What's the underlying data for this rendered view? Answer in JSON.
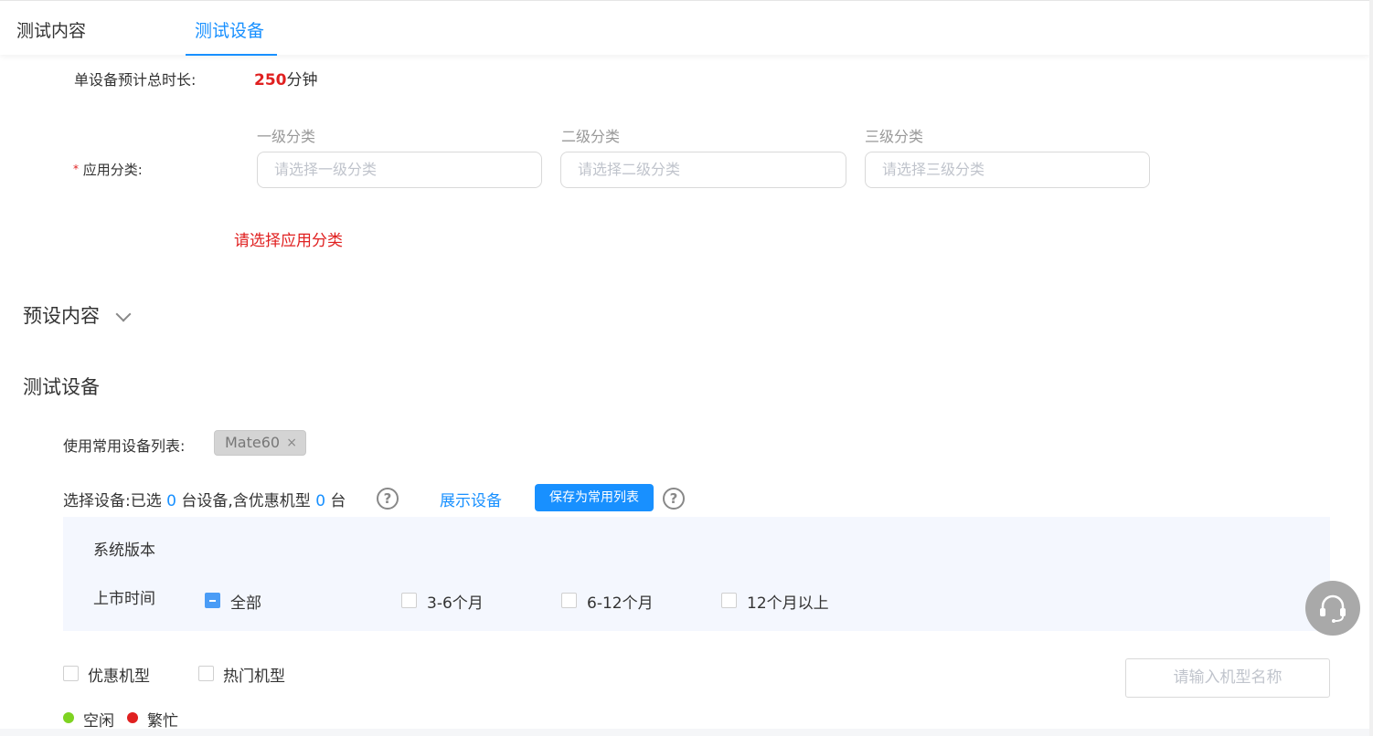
{
  "tabs": [
    {
      "label": "测试内容",
      "active": false
    },
    {
      "label": "测试设备",
      "active": true
    }
  ],
  "duration": {
    "label": "单设备预计总时长:",
    "value": "250",
    "unit": "分钟"
  },
  "app_category": {
    "required_mark": "*",
    "label": "应用分类:",
    "levels": [
      {
        "label": "一级分类",
        "placeholder": "请选择一级分类"
      },
      {
        "label": "二级分类",
        "placeholder": "请选择二级分类"
      },
      {
        "label": "三级分类",
        "placeholder": "请选择三级分类"
      }
    ],
    "error": "请选择应用分类"
  },
  "preset_section": {
    "title": "预设内容"
  },
  "device_section": {
    "title": "测试设备",
    "common_list_label": "使用常用设备列表:",
    "common_list_tag": "Mate60",
    "tag_close": "×",
    "select": {
      "prefix": "选择设备:已选",
      "count": "0",
      "middle": "台设备,含优惠机型",
      "discount_count": "0",
      "suffix": "台"
    },
    "show_devices_link": "展示设备",
    "save_button": "保存为常用列表",
    "help_glyph": "?",
    "filters": {
      "os_version_label": "系统版本",
      "release_label": "上市时间",
      "release_options": [
        {
          "label": "全部",
          "state": "indeterminate"
        },
        {
          "label": "3-6个月",
          "state": "unchecked"
        },
        {
          "label": "6-12个月",
          "state": "unchecked"
        },
        {
          "label": "12个月以上",
          "state": "unchecked"
        }
      ]
    },
    "type_options": [
      {
        "label": "优惠机型",
        "checked": false
      },
      {
        "label": "热门机型",
        "checked": false
      }
    ],
    "model_search_placeholder": "请输入机型名称",
    "legend": [
      {
        "label": "空闲",
        "color": "#7ed321"
      },
      {
        "label": "繁忙",
        "color": "#e02020"
      }
    ]
  },
  "colors": {
    "accent": "#1890ff",
    "error": "#e02020"
  }
}
